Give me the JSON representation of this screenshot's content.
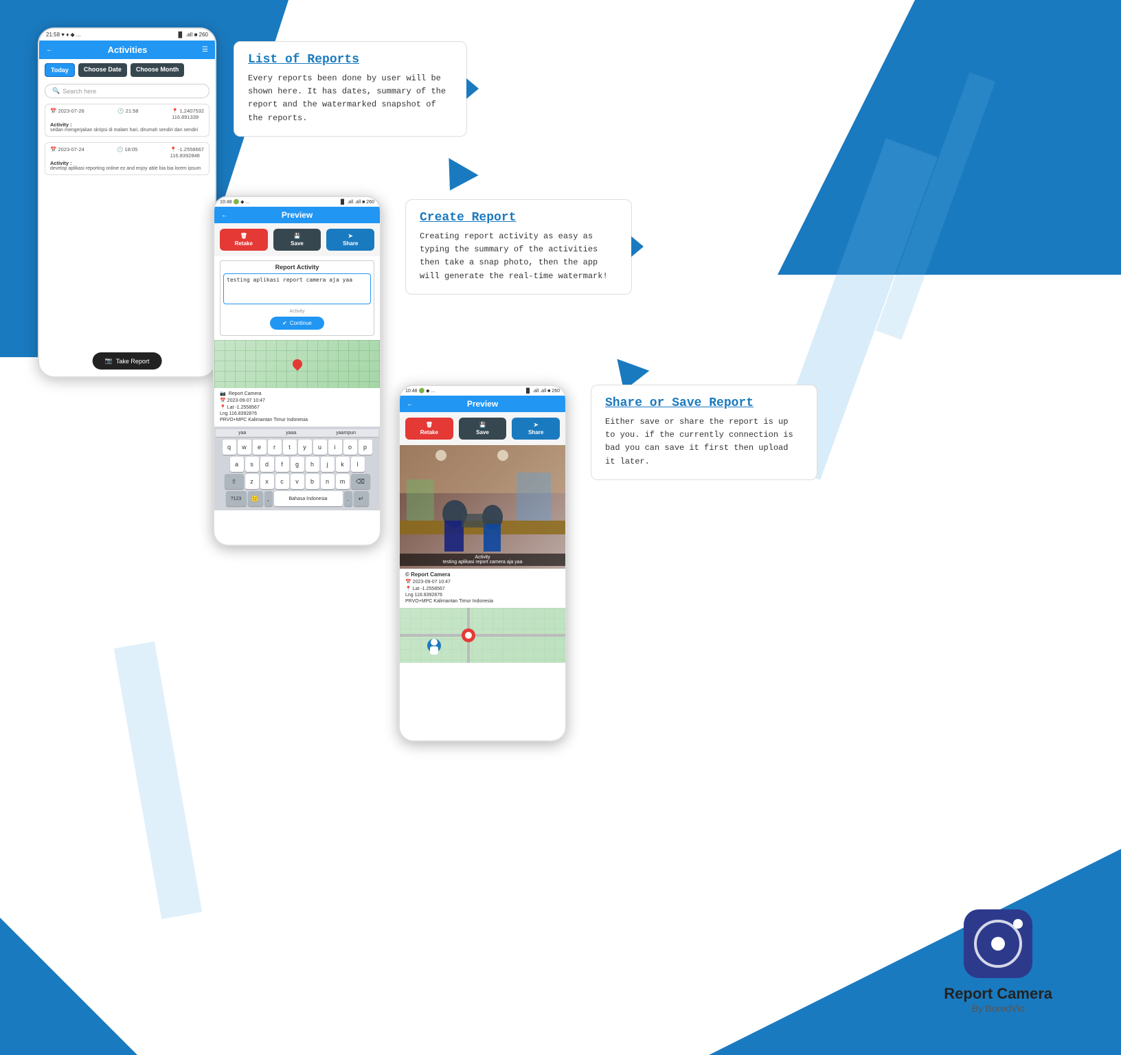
{
  "background": {
    "color_primary": "#1a7abf",
    "color_white": "#ffffff"
  },
  "phone1": {
    "status_bar": "21:58 ♥ ♦ ◆ ...",
    "status_right": "▐▌ .all ■ 260",
    "header_title": "Activities",
    "btn_today": "Today",
    "btn_choose_date": "Choose Date",
    "btn_choose_month": "Choose Month",
    "search_placeholder": "Search here",
    "activity1_date": "2023-07-26",
    "activity1_time": "21:58",
    "activity1_lat": "1,2407532",
    "activity1_lng": "116.891339",
    "activity1_label": "Activity :",
    "activity1_text": "sedan mengerjakan skripsi di malam hari, dirumah sendiri dan sendiri",
    "activity2_date": "2023-07-24",
    "activity2_time": "18:05",
    "activity2_lat": "-1.2558667",
    "activity2_lng": "116.8392848",
    "activity2_label": "Activity :",
    "activity2_text": "develop aplikasi reporting online ez and enjoy able bia bia lorem ipsum",
    "take_report_btn": "Take Report"
  },
  "feature1": {
    "title": "List of Reports",
    "text": "Every reports been done by user will be shown here. It has dates, summary of the report and the watermarked snapshot of the reports."
  },
  "phone2": {
    "status_bar": "10:48 🟢 ◆ ...",
    "status_right": "▐▌ .all .all ■ 260",
    "header_title": "Preview",
    "btn_retake": "Retake",
    "btn_save": "Save",
    "btn_share": "Share",
    "report_activity_title": "Report Activity",
    "report_textarea_value": "testing aplikasi report camera aja yaa",
    "activity_label": "Activity",
    "continue_btn": "Continue",
    "suggestions": [
      "yaa",
      "yaaa",
      "yaampun"
    ],
    "keyboard_row1": [
      "q",
      "w",
      "e",
      "r",
      "t",
      "y",
      "u",
      "i",
      "o",
      "p"
    ],
    "keyboard_row2": [
      "a",
      "s",
      "d",
      "f",
      "g",
      "h",
      "j",
      "k",
      "l"
    ],
    "keyboard_row3": [
      "z",
      "x",
      "c",
      "v",
      "b",
      "n",
      "m"
    ],
    "keyboard_bottom": [
      "?123",
      "🙂",
      "·",
      "Bahasa Indonesia",
      "·",
      "↵"
    ],
    "report_camera_label": "Report Camera",
    "report_date": "2023-09-07 10:47",
    "report_lat": "Lat -1.2558567",
    "report_lng": "Lng 116.8392876",
    "report_location": "PRVO+MPC Kalimantan Timur Indonesia"
  },
  "feature2": {
    "title": "Create Report",
    "text": "Creating report activity as easy as typing the summary of the activities then take a snap photo, then the app will generate the real-time watermark!"
  },
  "phone3": {
    "status_bar": "10:48 🟢 ◆ ...",
    "status_right": "▐▌ .all .all ■ 260",
    "header_title": "Preview",
    "btn_retake": "Retake",
    "btn_save": "Save",
    "btn_share": "Share",
    "activity_watermark": "Activity",
    "activity_text": "testing aplikasi report camera aja yaa",
    "report_camera_label": "© Report Camera",
    "report_date": "2023-09-07 10:47",
    "report_lat": "Lat -1.2558567",
    "report_lng": "Lng 116.8392876",
    "report_location": "PRVO+MPC Kalimantan Timur Indonesia"
  },
  "feature3": {
    "title": "Share or Save Report",
    "text": "Either save or share the report is up to you. if the currently connection is bad you can save it first then upload it later."
  },
  "app": {
    "name": "Report Camera",
    "by": "By BoredVio"
  }
}
